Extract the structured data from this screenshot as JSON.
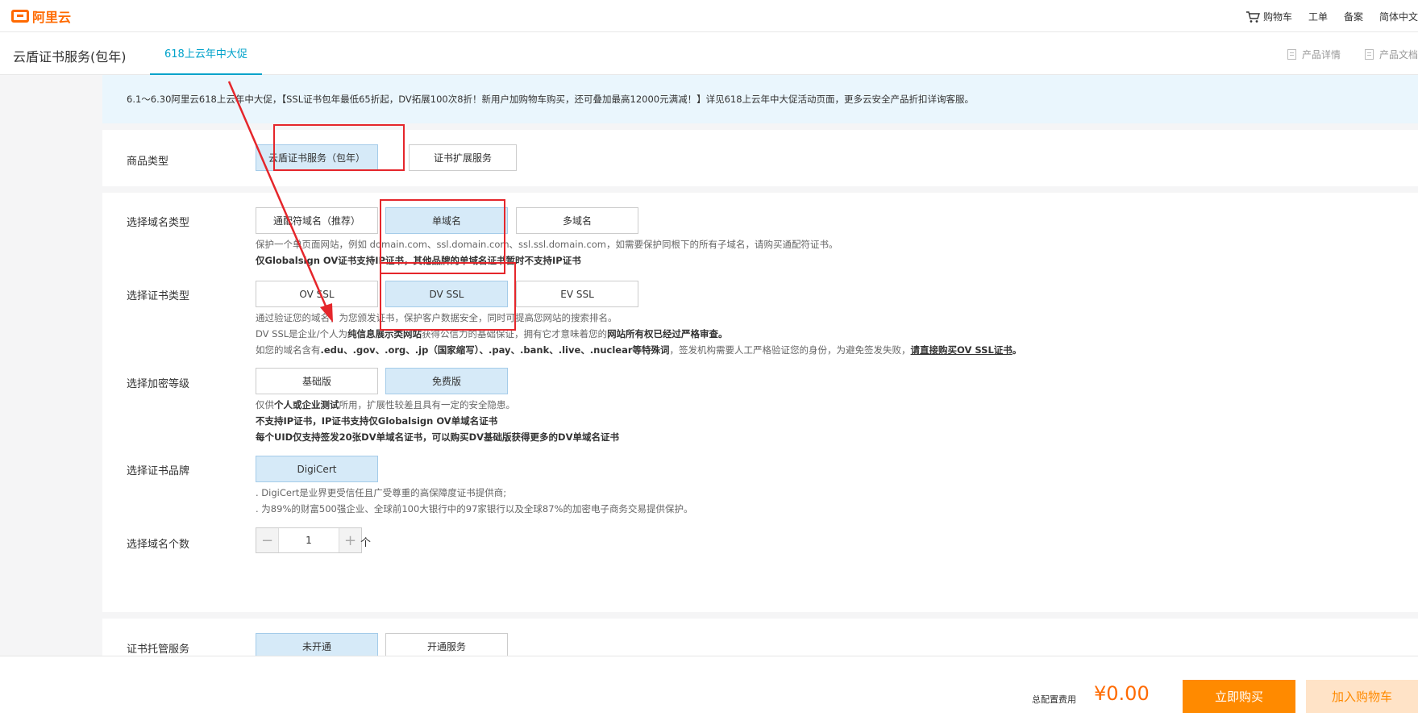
{
  "header": {
    "logo_text": "阿里云",
    "cart": "购物车",
    "ticket": "工单",
    "filing": "备案",
    "language": "简体中文"
  },
  "subheader": {
    "product_title": "云盾证书服务(包年)",
    "promo_tab": "618上云年中大促",
    "product_detail": "产品详情",
    "product_doc": "产品文档"
  },
  "notice": "6.1～6.30阿里云618上云年中大促，【SSL证书包年最低65折起，DV拓展100次8折！新用户加购物车购买，还可叠加最高12000元满减！】详见618上云年中大促活动页面，更多云安全产品折扣详询客服。",
  "product_type": {
    "label": "商品类型",
    "options": [
      "云盾证书服务（包年）",
      "证书扩展服务"
    ]
  },
  "domain_type": {
    "label": "选择域名类型",
    "options": [
      "通配符域名（推荐）",
      "单域名",
      "多域名"
    ],
    "desc1": "保护一个单页面网站，例如 domain.com、ssl.domain.com、ssl.ssl.domain.com，如需要保护同根下的所有子域名，请购买通配符证书。",
    "desc2": "仅Globalsign OV证书支持IP证书，其他品牌的单域名证书暂时不支持IP证书"
  },
  "cert_type": {
    "label": "选择证书类型",
    "options": [
      "OV SSL",
      "DV SSL",
      "EV SSL"
    ],
    "desc1": "通过验证您的域名，为您颁发证书，保护客户数据安全，同时可提高您网站的搜索排名。",
    "desc2_a": "DV SSL是企业/个人为",
    "desc2_b": "纯信息展示类网站",
    "desc2_c": "获得公信力的基础保证，拥有它才意味着您的",
    "desc2_d": "网站所有权已经过严格审查。",
    "desc3_a": "如您的域名含有",
    "desc3_b": ".edu、.gov、.org、.jp（国家缩写）、.pay、.bank、.live、.nuclear等特殊词",
    "desc3_c": "，签发机构需要人工严格验证您的身份，为避免签发失败，",
    "desc3_link": "请直接购买OV SSL证书",
    "desc3_end": "。"
  },
  "encrypt_level": {
    "label": "选择加密等级",
    "options": [
      "基础版",
      "免费版"
    ],
    "desc1_a": "仅供",
    "desc1_b": "个人或企业测试",
    "desc1_c": "所用，扩展性较差且具有一定的安全隐患。",
    "desc2": "不支持IP证书，IP证书支持仅Globalsign OV单域名证书",
    "desc3": "每个UID仅支持签发20张DV单域名证书，可以购买DV基础版获得更多的DV单域名证书"
  },
  "brand": {
    "label": "选择证书品牌",
    "options": [
      "DigiCert"
    ],
    "desc1": ". DigiCert是业界更受信任且广受尊重的高保障度证书提供商;",
    "desc2": ". 为89%的财富500强企业、全球前100大银行中的97家银行以及全球87%的加密电子商务交易提供保护。"
  },
  "domain_count": {
    "label": "选择域名个数",
    "minus": "−",
    "value": "1",
    "plus": "+",
    "unit": "个"
  },
  "hosting": {
    "label": "证书托管服务",
    "options": [
      "未开通",
      "开通服务"
    ]
  },
  "footer": {
    "total_label": "总配置费用",
    "total_price": "¥0.00",
    "buy_now": "立即购买",
    "add_cart": "加入购物车"
  },
  "colors": {
    "brand": "#ff6a00",
    "accent": "#00a2ca",
    "selected_bg": "#d6eaf8",
    "annotation": "#e5262b"
  }
}
